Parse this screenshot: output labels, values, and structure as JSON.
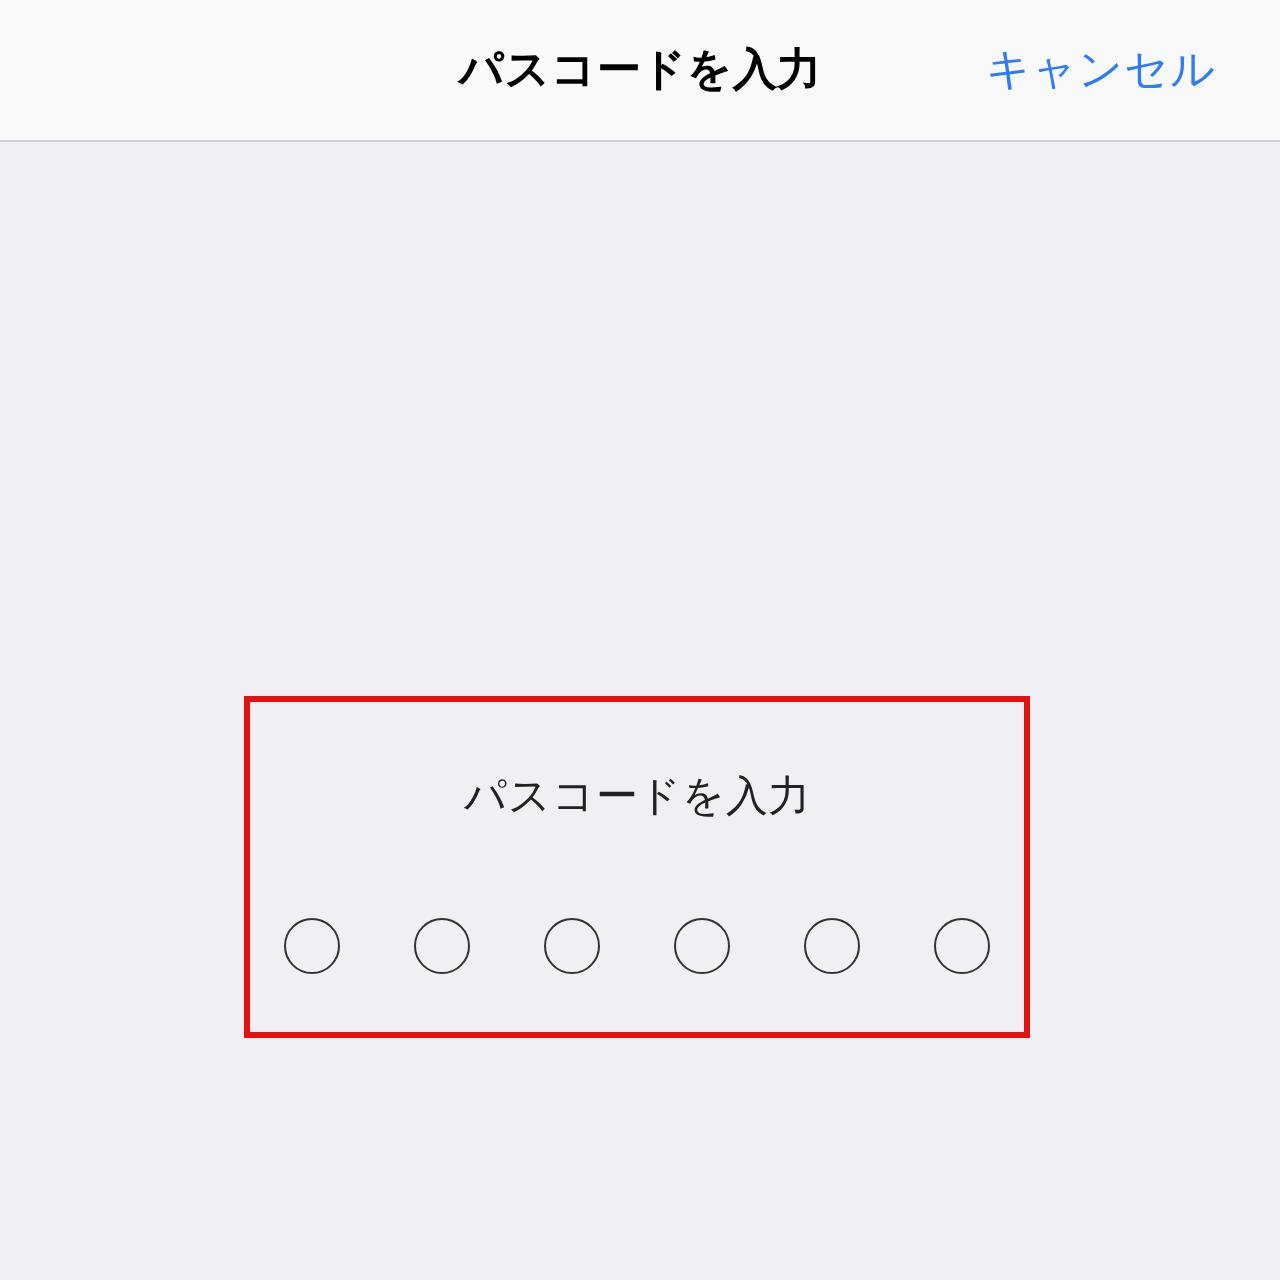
{
  "nav_bar": {
    "title": "パスコードを入力",
    "cancel": "キャンセル"
  },
  "passcode": {
    "prompt": "パスコードを入力",
    "digits": [
      {
        "filled": false
      },
      {
        "filled": false
      },
      {
        "filled": false
      },
      {
        "filled": false
      },
      {
        "filled": false
      },
      {
        "filled": false
      }
    ]
  }
}
